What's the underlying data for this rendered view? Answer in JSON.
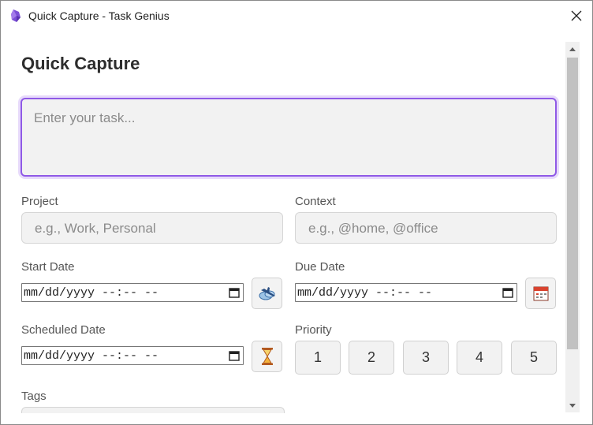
{
  "window": {
    "title": "Quick Capture - Task Genius",
    "app_icon": "obsidian-icon",
    "close_icon": "close-icon"
  },
  "form": {
    "heading": "Quick Capture",
    "task_placeholder": "Enter your task...",
    "project": {
      "label": "Project",
      "placeholder": "e.g., Work, Personal"
    },
    "context": {
      "label": "Context",
      "placeholder": "e.g., @home, @office"
    },
    "start_date": {
      "label": "Start Date",
      "value": "mm/dd/yyyy --:-- --",
      "icon": "airplane-departure-icon"
    },
    "due_date": {
      "label": "Due Date",
      "value": "mm/dd/yyyy --:-- --",
      "icon": "calendar-icon"
    },
    "scheduled_date": {
      "label": "Scheduled Date",
      "value": "mm/dd/yyyy --:-- --",
      "icon": "hourglass-icon"
    },
    "priority": {
      "label": "Priority",
      "options": [
        "1",
        "2",
        "3",
        "4",
        "5"
      ]
    },
    "tags": {
      "label": "Tags"
    }
  },
  "colors": {
    "accent": "#8f59e6",
    "input_bg": "#f2f2f2"
  }
}
